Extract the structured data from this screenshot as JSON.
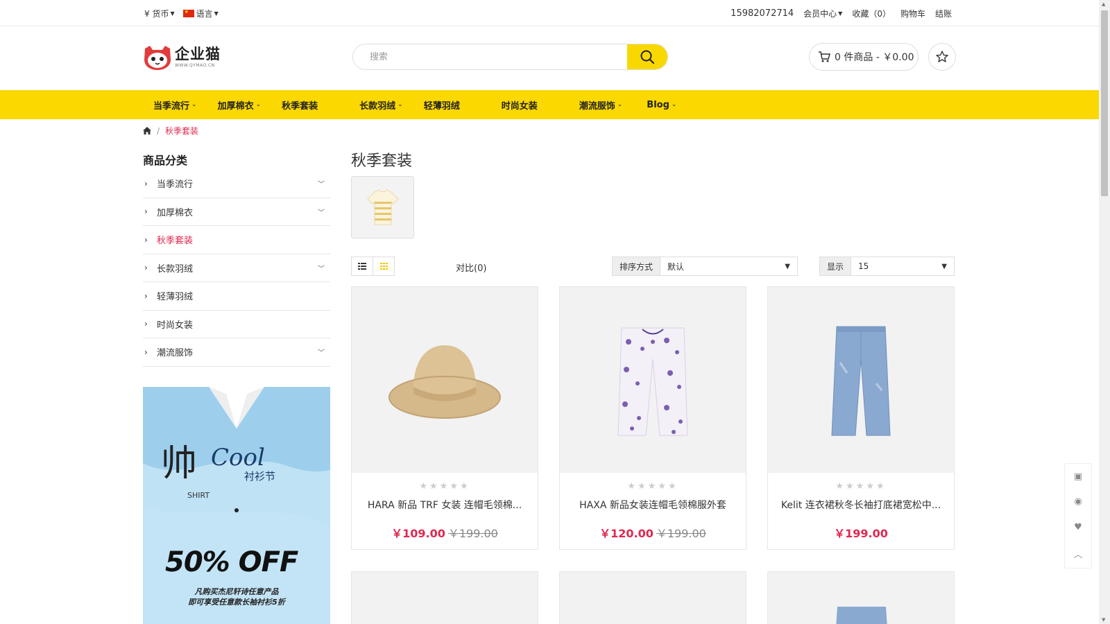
{
  "topbar": {
    "currency_symbol": "¥",
    "currency_label": "货币",
    "language_label": "语言",
    "phone": "15982072714",
    "member_center": "会员中心",
    "favorites": "收藏（0）",
    "cart": "购物车",
    "checkout": "结账"
  },
  "header": {
    "logo_cn": "企业猫",
    "logo_en": "WWW.QYMAO.CN",
    "search_placeholder": "搜索",
    "cart_summary": "0 件商品 - ￥0.00"
  },
  "nav": {
    "items": [
      {
        "label": "当季流行",
        "has_dropdown": true
      },
      {
        "label": "加厚棉衣",
        "has_dropdown": true
      },
      {
        "label": "秋季套装",
        "has_dropdown": false
      },
      {
        "label": "长款羽绒",
        "has_dropdown": true
      },
      {
        "label": "轻薄羽绒",
        "has_dropdown": false
      },
      {
        "label": "时尚女装",
        "has_dropdown": false
      },
      {
        "label": "潮流服饰",
        "has_dropdown": true
      },
      {
        "label": "Blog",
        "has_dropdown": true
      }
    ]
  },
  "breadcrumb": {
    "home_icon": "home-icon",
    "current": "秋季套装"
  },
  "sidebar": {
    "title": "商品分类",
    "items": [
      {
        "label": "当季流行",
        "expandable": true
      },
      {
        "label": "加厚棉衣",
        "expandable": true
      },
      {
        "label": "秋季套装",
        "expandable": false,
        "active": true
      },
      {
        "label": "长款羽绒",
        "expandable": true
      },
      {
        "label": "轻薄羽绒",
        "expandable": false
      },
      {
        "label": "时尚女装",
        "expandable": false
      },
      {
        "label": "潮流服饰",
        "expandable": true
      }
    ],
    "banner": {
      "cool_text": "Cool",
      "cn_big": "帅",
      "cn_sub": "衬衫节",
      "shirt_label": "SHIRT",
      "discount": "50% OFF",
      "line1": "凡购买杰尼轩诗任意产品",
      "line2": "即可享受任意款长袖衬衫5折"
    }
  },
  "main": {
    "title": "秋季套装",
    "compare": "对比(0)",
    "sort_label": "排序方式",
    "sort_value": "默认",
    "show_label": "显示",
    "show_value": "15"
  },
  "products": [
    {
      "name": "HARA 新品 TRF 女装 连帽毛领棉...",
      "price": "￥109.00",
      "old_price": "￥199.00",
      "image": "hat"
    },
    {
      "name": "HAXA 新品女装连帽毛领棉服外套",
      "price": "￥120.00",
      "old_price": "￥199.00",
      "image": "floral-pants"
    },
    {
      "name": "Kelit 连衣裙秋冬长袖打底裙宽松中...",
      "price": "￥199.00",
      "old_price": "",
      "image": "jeans"
    }
  ],
  "colors": {
    "accent": "#fbd800",
    "price": "#e0284f",
    "active_link": "#e0284f"
  }
}
